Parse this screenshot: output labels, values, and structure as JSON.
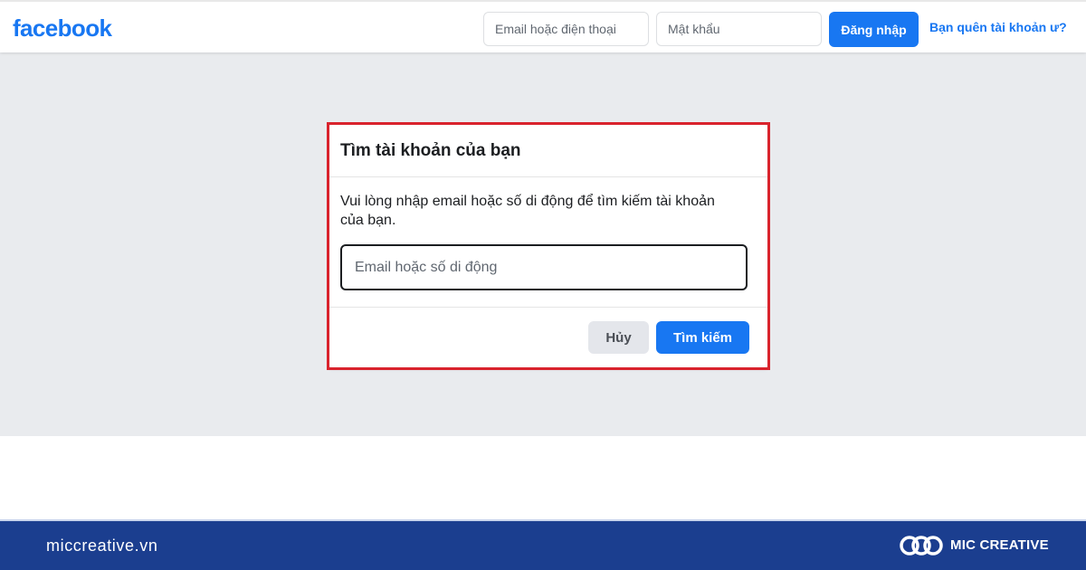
{
  "navbar": {
    "logo_text": "facebook",
    "email_placeholder": "Email hoặc điện thoại",
    "password_placeholder": "Mật khẩu",
    "login_label": "Đăng nhập",
    "forgot_label": "Bạn quên tài khoản ư?"
  },
  "dialog": {
    "title": "Tìm tài khoản của bạn",
    "description": "Vui lòng nhập email hoặc số di động để tìm kiếm tài khoản của bạn.",
    "input_placeholder": "Email hoặc số di động",
    "input_value": "",
    "cancel_label": "Hủy",
    "search_label": "Tìm kiếm"
  },
  "brand": {
    "site": "miccreative.vn",
    "name": "MIC CREATIVE",
    "logo_icon": "mic-creative-logo-icon"
  },
  "colors": {
    "facebook_blue": "#1877f2",
    "highlight_red": "#d9232d",
    "brand_bar": "#1b3e8f",
    "content_gray": "#e9ebee"
  }
}
